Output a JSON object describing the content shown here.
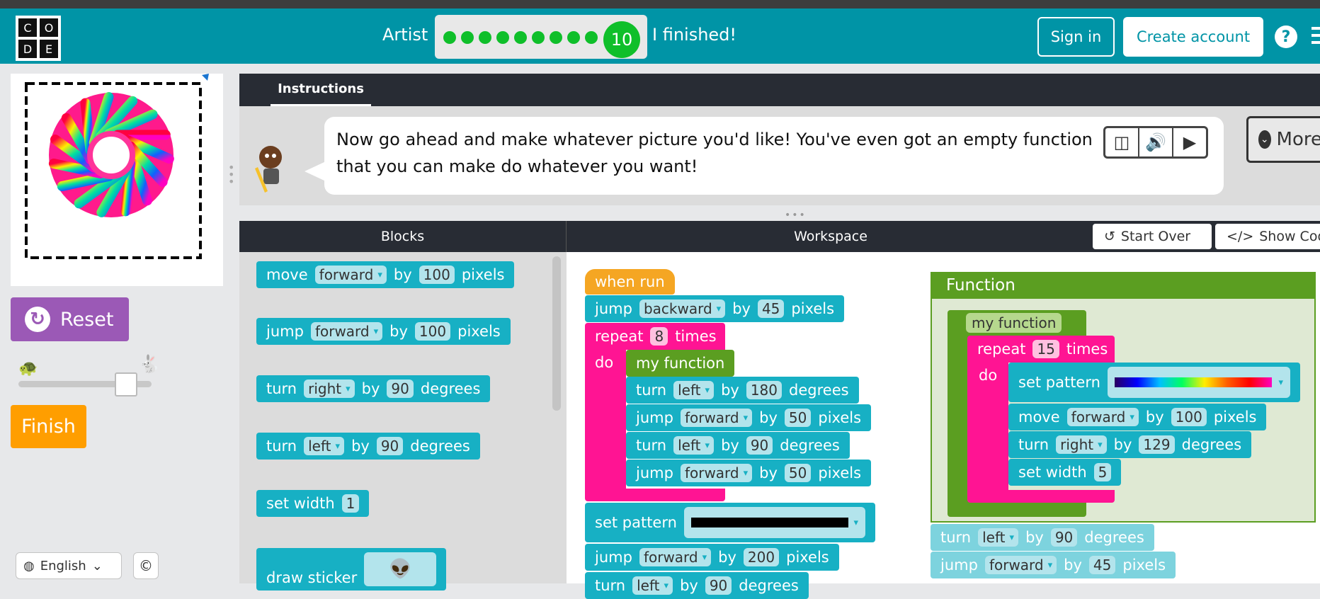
{
  "header": {
    "logo_letters": [
      "C",
      "O",
      "D",
      "E"
    ],
    "level_label": "Artist",
    "current_level": "10",
    "finished_label": "I finished!",
    "sign_in": "Sign in",
    "create_account": "Create account",
    "help": "?"
  },
  "left": {
    "reset": "Reset",
    "finish": "Finish",
    "language": "English",
    "speed_level": 0.85
  },
  "instructions": {
    "tab": "Instructions",
    "text": "Now go ahead and make whatever picture you'd like! You've even got an empty function that you can make do whatever you want!",
    "more": "More"
  },
  "workspace_header": {
    "blocks": "Blocks",
    "workspace": "Workspace",
    "start_over": "Start Over",
    "show_code": "Show Code"
  },
  "toolbox": {
    "b1": {
      "a": "move",
      "f1": "forward",
      "b": "by",
      "f2": "100",
      "c": "pixels"
    },
    "b2": {
      "a": "jump",
      "f1": "forward",
      "b": "by",
      "f2": "100",
      "c": "pixels"
    },
    "b3": {
      "a": "turn",
      "f1": "right",
      "b": "by",
      "f2": "90",
      "c": "degrees"
    },
    "b4": {
      "a": "turn",
      "f1": "left",
      "b": "by",
      "f2": "90",
      "c": "degrees"
    },
    "b5": {
      "a": "set width",
      "f1": "1"
    },
    "b6": {
      "a": "draw sticker"
    }
  },
  "program": {
    "when_run": "when run",
    "s1": {
      "a": "jump",
      "f1": "backward",
      "b": "by",
      "f2": "45",
      "c": "pixels"
    },
    "repeat": {
      "a": "repeat",
      "n": "8",
      "b": "times",
      "do": "do"
    },
    "call": "my function",
    "s2": {
      "a": "turn",
      "f1": "left",
      "b": "by",
      "f2": "180",
      "c": "degrees"
    },
    "s3": {
      "a": "jump",
      "f1": "forward",
      "b": "by",
      "f2": "50",
      "c": "pixels"
    },
    "s4": {
      "a": "turn",
      "f1": "left",
      "b": "by",
      "f2": "90",
      "c": "degrees"
    },
    "s5": {
      "a": "jump",
      "f1": "forward",
      "b": "by",
      "f2": "50",
      "c": "pixels"
    },
    "s6": {
      "a": "set pattern"
    },
    "s7": {
      "a": "jump",
      "f1": "forward",
      "b": "by",
      "f2": "200",
      "c": "pixels"
    },
    "s8": {
      "a": "turn",
      "f1": "left",
      "b": "by",
      "f2": "90",
      "c": "degrees"
    }
  },
  "function": {
    "title": "Function",
    "name": "my function",
    "repeat": {
      "a": "repeat",
      "n": "15",
      "b": "times",
      "do": "do"
    },
    "f1": {
      "a": "set pattern"
    },
    "f2": {
      "a": "move",
      "f1": "forward",
      "b": "by",
      "f2": "100",
      "c": "pixels"
    },
    "f3": {
      "a": "turn",
      "f1": "right",
      "b": "by",
      "f2": "129",
      "c": "degrees"
    },
    "f4": {
      "a": "set width",
      "f1": "5"
    },
    "g1": {
      "a": "turn",
      "f1": "left",
      "b": "by",
      "f2": "90",
      "c": "degrees"
    },
    "g2": {
      "a": "jump",
      "f1": "forward",
      "b": "by",
      "f2": "45",
      "c": "pixels"
    }
  },
  "colors": {
    "teal": "#0094a6",
    "block": "#17b0c4",
    "loop": "#ff1493",
    "function": "#5b9e21",
    "event": "#f5a623",
    "reset": "#9b59b6",
    "finish": "#ff9e00",
    "progress": "#0fbf2a"
  }
}
